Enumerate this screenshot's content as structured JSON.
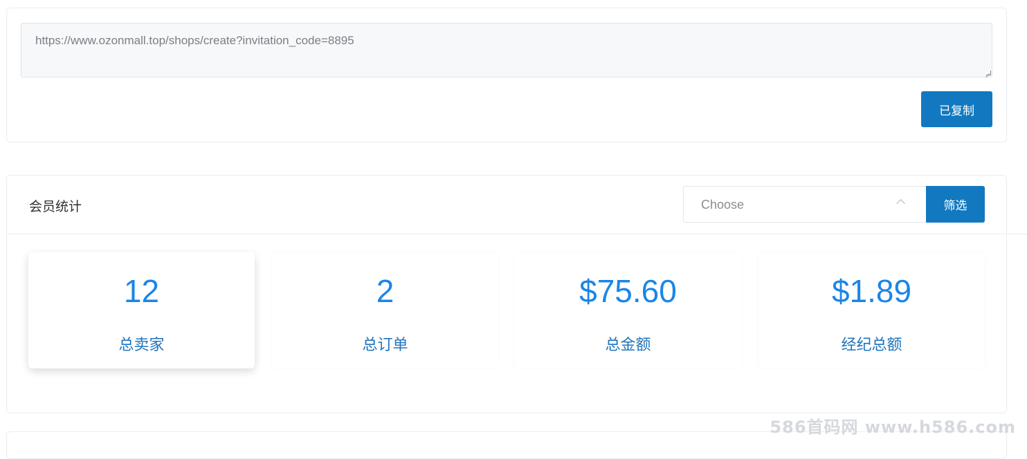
{
  "invite": {
    "url": "https://www.ozonmall.top/shops/create?invitation_code=8895",
    "copy_button": "已复制"
  },
  "stats": {
    "title": "会员统计",
    "select_placeholder": "Choose",
    "filter_button": "筛选",
    "items": [
      {
        "value": "12",
        "label": "总卖家"
      },
      {
        "value": "2",
        "label": "总订单"
      },
      {
        "value": "$75.60",
        "label": "总金额"
      },
      {
        "value": "$1.89",
        "label": "经纪总额"
      }
    ]
  },
  "watermark": "586首码网 www.h586.com"
}
